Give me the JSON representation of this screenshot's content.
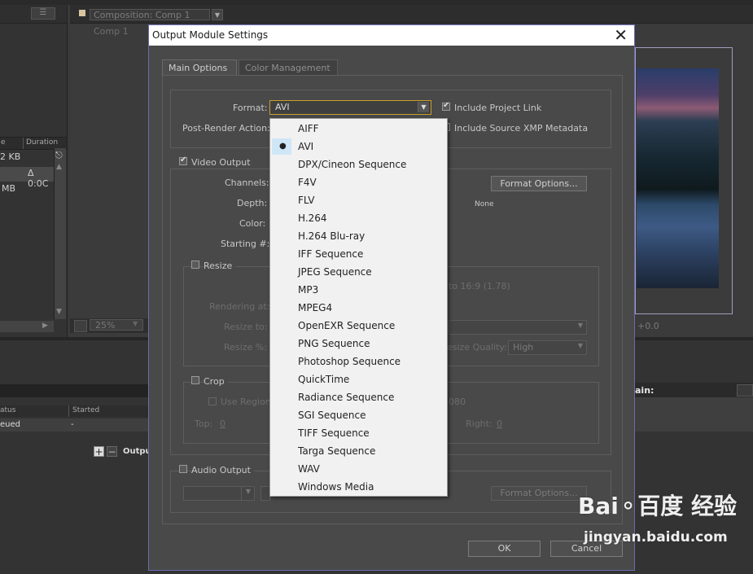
{
  "background": {
    "comp_tab": "Composition: Comp 1",
    "comp_sub": "Comp 1",
    "col_left": "e",
    "col_duration": "Duration",
    "rows": [
      "2 KB",
      "Δ 0:0C",
      "MB"
    ],
    "zoom": "25%",
    "footer_val": "+0.0",
    "rq_status": "atus",
    "rq_started": "Started",
    "rq_row_status": "eued",
    "rq_row_started": "-",
    "output_label": "Output",
    "right_label": "ain:"
  },
  "dialog": {
    "title": "Output Module Settings",
    "tabs": [
      "Main Options",
      "Color Management"
    ],
    "format_label": "Format:",
    "format_value": "AVI",
    "post_render_label": "Post-Render Action:",
    "include_project_link": "Include Project Link",
    "include_xmp": "Include Source XMP Metadata",
    "video_output": "Video Output",
    "channels_label": "Channels:",
    "depth_label": "Depth:",
    "color_label": "Color:",
    "starting_label": "Starting #:",
    "format_options": "Format Options...",
    "none_text": "None",
    "resize": "Resize",
    "rendering_at": "Rendering at:",
    "resize_to": "Resize to:",
    "resize_pct": "Resize %:",
    "aspect_text": "to 16:9 (1.78)",
    "resize_quality_label": "esize Quality:",
    "resize_quality_value": "High",
    "crop": "Crop",
    "use_region": "Use Region",
    "crop_top": "Top:",
    "crop_top_val": "0",
    "crop_right": "Right:",
    "crop_right_val": "0",
    "crop_dim_val": "080",
    "audio_output": "Audio Output",
    "audio_format_options": "Format Options...",
    "ok": "OK",
    "cancel": "Cancel"
  },
  "dropdown": {
    "selected": "AVI",
    "items": [
      "AIFF",
      "AVI",
      "DPX/Cineon Sequence",
      "F4V",
      "FLV",
      "H.264",
      "H.264 Blu-ray",
      "IFF Sequence",
      "JPEG Sequence",
      "MP3",
      "MPEG4",
      "OpenEXR Sequence",
      "PNG Sequence",
      "Photoshop Sequence",
      "QuickTime",
      "Radiance Sequence",
      "SGI Sequence",
      "TIFF Sequence",
      "Targa Sequence",
      "WAV",
      "Windows Media"
    ]
  },
  "watermark": {
    "main": "Bai⚬百度 经验",
    "sub": "jingyan.baidu.com"
  }
}
